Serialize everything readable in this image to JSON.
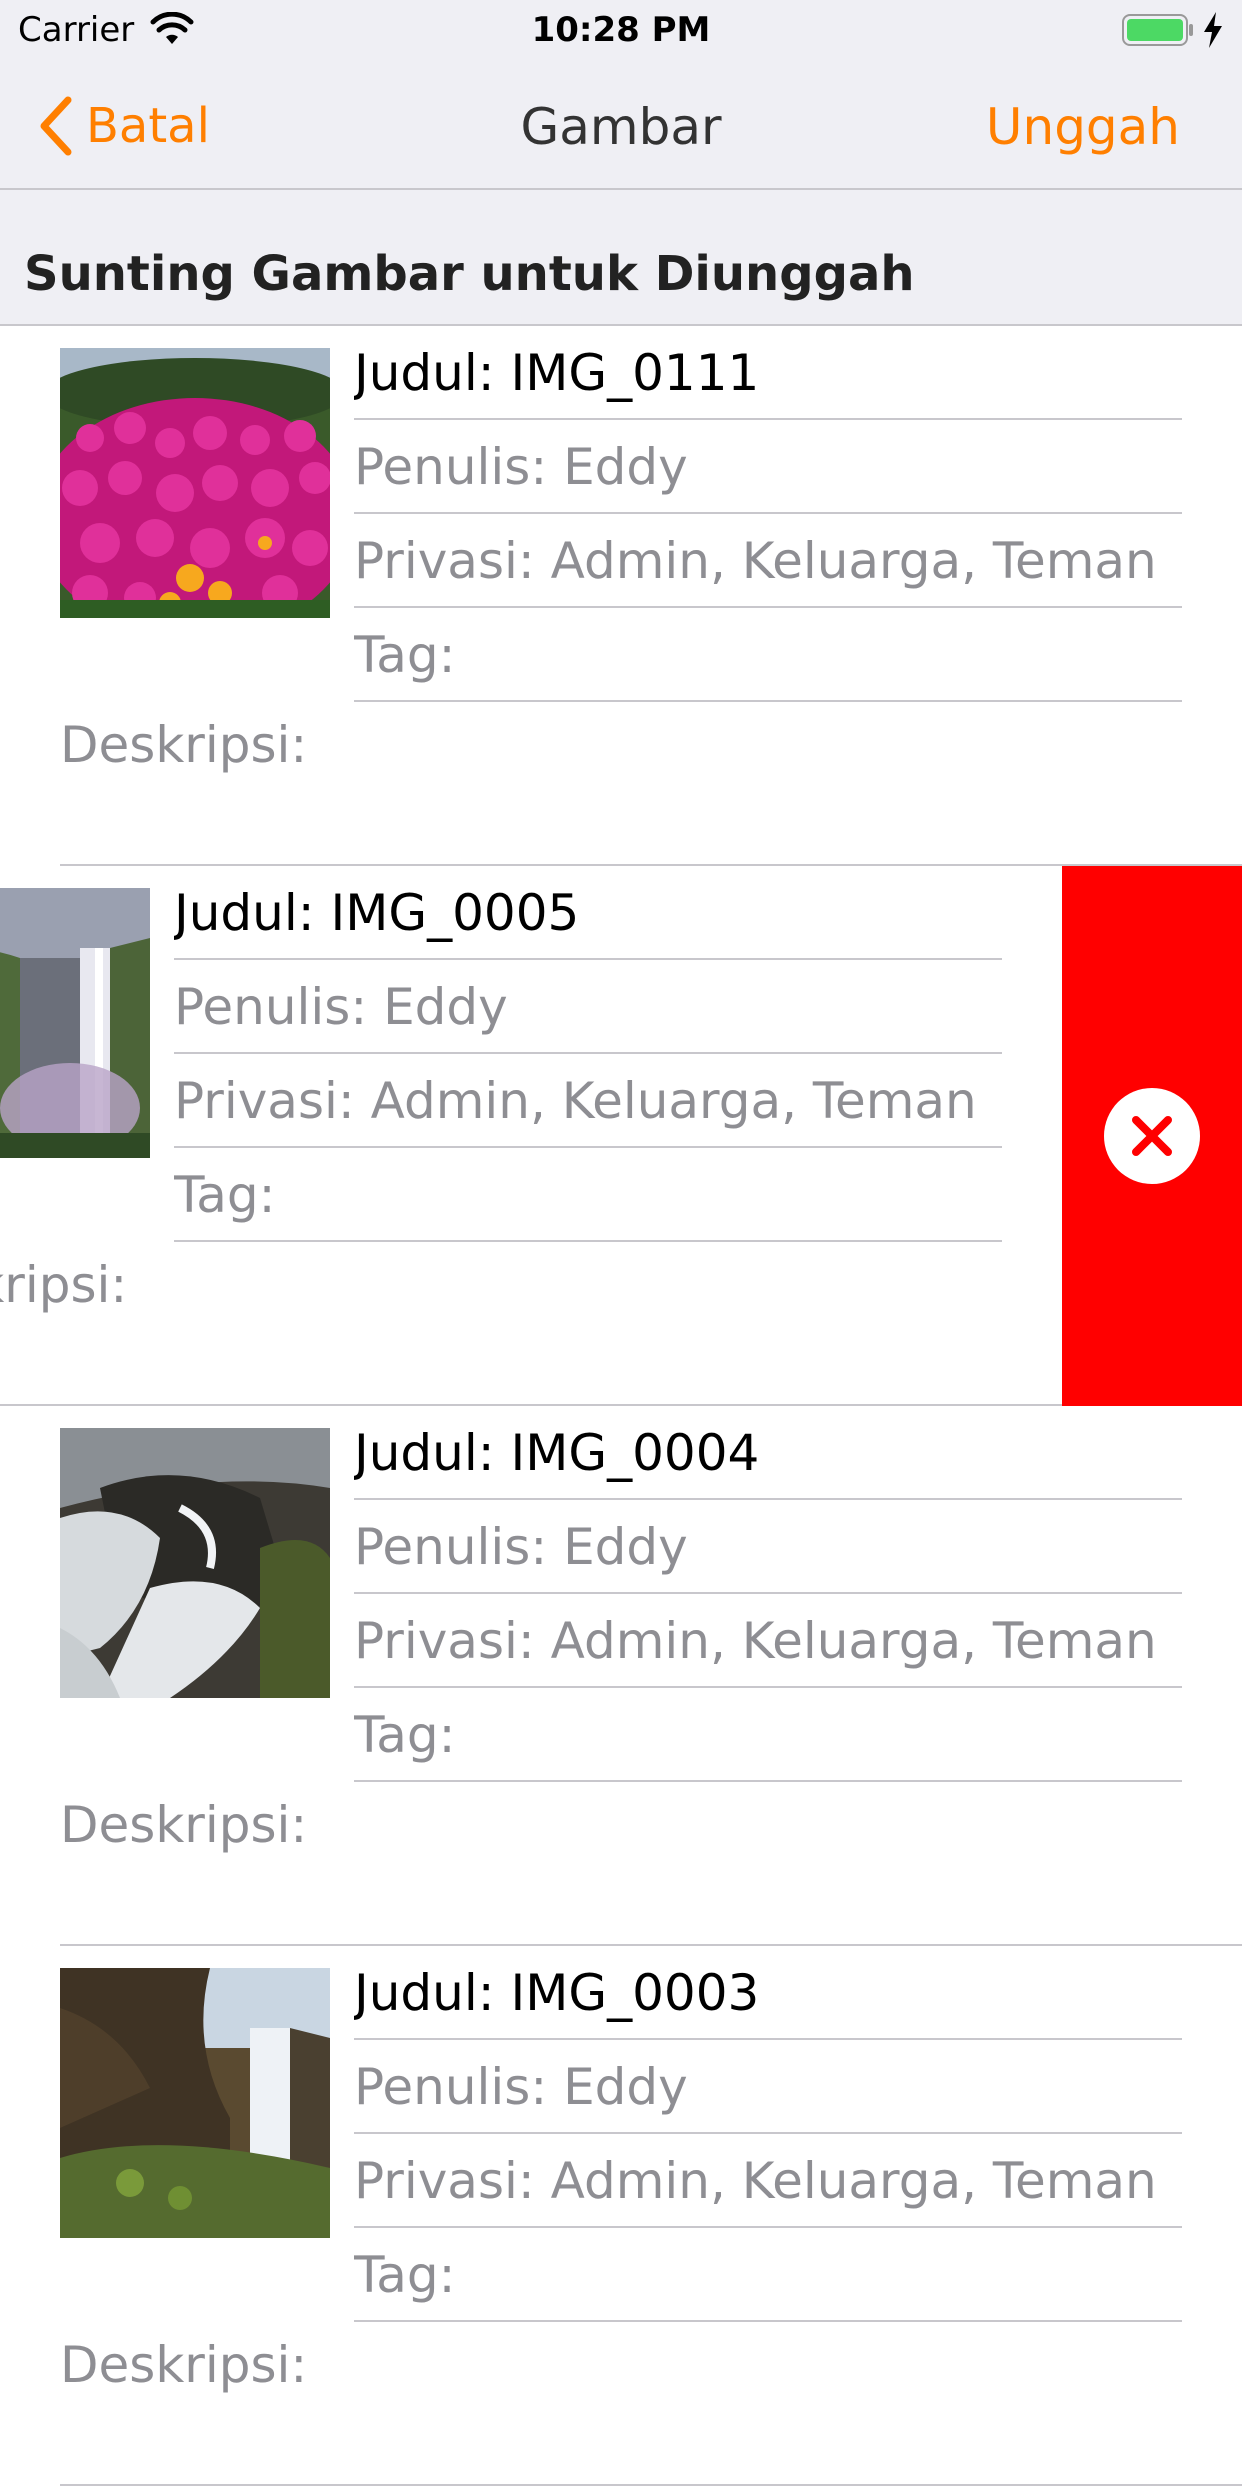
{
  "status_bar": {
    "carrier": "Carrier",
    "time": "10:28 PM"
  },
  "nav": {
    "back_label": "Batal",
    "title": "Gambar",
    "upload_label": "Unggah"
  },
  "section": {
    "title": "Sunting Gambar untuk Diunggah"
  },
  "images": [
    {
      "title": "Judul: IMG_0111",
      "author": "Penulis: Eddy",
      "privacy": "Privasi: Admin, Keluarga, Teman",
      "tags": "Tag:",
      "description": "Deskripsi:",
      "thumbnail": "pink-flowers",
      "swiped": false
    },
    {
      "title": "Judul: IMG_0005",
      "author": "Penulis: Eddy",
      "privacy": "Privasi: Admin, Keluarga, Teman",
      "tags": "Tag:",
      "description": "Deskripsi:",
      "thumbnail": "waterfall",
      "swiped": true
    },
    {
      "title": "Judul: IMG_0004",
      "author": "Penulis: Eddy",
      "privacy": "Privasi: Admin, Keluarga, Teman",
      "tags": "Tag:",
      "description": "Deskripsi:",
      "thumbnail": "rocky-stream",
      "swiped": false
    },
    {
      "title": "Judul: IMG_0003",
      "author": "Penulis: Eddy",
      "privacy": "Privasi: Admin, Keluarga, Teman",
      "tags": "Tag:",
      "description": "Deskripsi:",
      "thumbnail": "cliff-waterfall",
      "swiped": false
    }
  ],
  "colors": {
    "accent": "#ff7f00",
    "delete": "#ff0000",
    "separator": "#c8c7cc",
    "bar_background": "#efeff4"
  }
}
